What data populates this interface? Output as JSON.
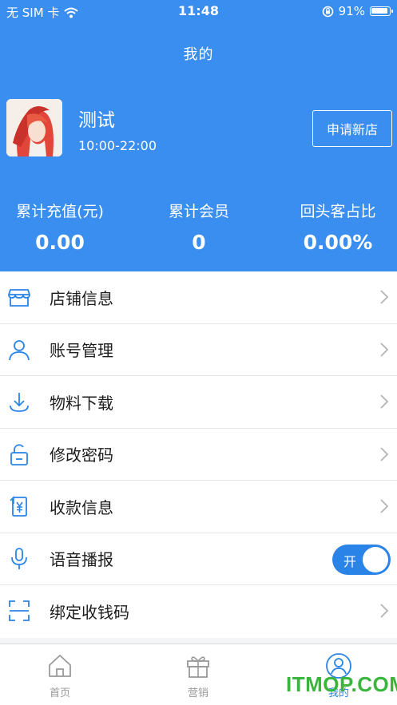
{
  "status_bar": {
    "carrier": "无 SIM 卡",
    "time": "11:48",
    "battery": "91%"
  },
  "header": {
    "title": "我的",
    "store_name": "测试",
    "store_hours": "10:00-22:00",
    "apply_button": "申请新店"
  },
  "stats": [
    {
      "label": "累计充值(元)",
      "value": "0.00"
    },
    {
      "label": "累计会员",
      "value": "0"
    },
    {
      "label": "回头客占比",
      "value": "0.00%"
    }
  ],
  "menu": {
    "items": [
      {
        "label": "店铺信息",
        "icon": "store-icon"
      },
      {
        "label": "账号管理",
        "icon": "user-icon"
      },
      {
        "label": "物料下载",
        "icon": "download-icon"
      },
      {
        "label": "修改密码",
        "icon": "lock-icon"
      },
      {
        "label": "收款信息",
        "icon": "yuan-receipt-icon"
      },
      {
        "label": "语音播报",
        "icon": "microphone-icon",
        "toggle": "开"
      },
      {
        "label": "绑定收钱码",
        "icon": "scan-icon"
      }
    ]
  },
  "tabbar": {
    "tabs": [
      {
        "label": "首页",
        "icon": "home-icon"
      },
      {
        "label": "营销",
        "icon": "gift-icon"
      },
      {
        "label": "我的",
        "icon": "profile-icon"
      }
    ]
  },
  "watermark": "ITMOP.COM",
  "colors": {
    "primary": "#3a8ef0",
    "accent": "#2a84e8",
    "watermark": "#38b53a"
  }
}
